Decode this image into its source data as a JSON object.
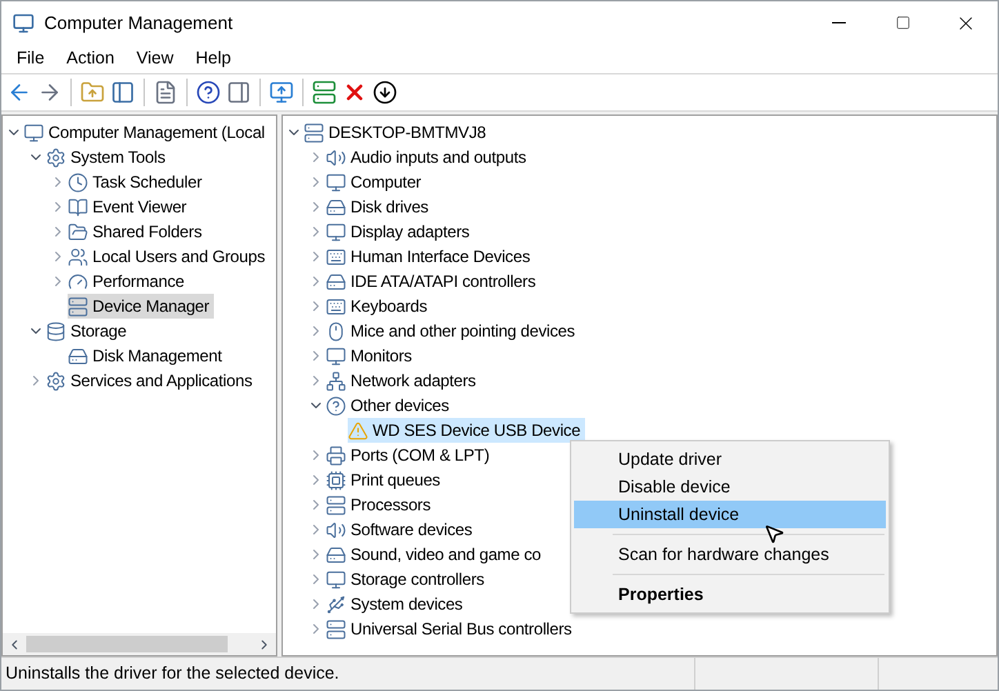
{
  "window": {
    "title": "Computer Management"
  },
  "menu": [
    {
      "label": "File"
    },
    {
      "label": "Action"
    },
    {
      "label": "View"
    },
    {
      "label": "Help"
    }
  ],
  "left_tree": [
    {
      "label": "Computer Management (Local",
      "expanded": true,
      "selected": false,
      "children": [
        {
          "label": "System Tools",
          "expanded": true,
          "selected": false,
          "children": [
            {
              "label": "Task Scheduler",
              "expanded": false,
              "selected": false
            },
            {
              "label": "Event Viewer",
              "expanded": false,
              "selected": false
            },
            {
              "label": "Shared Folders",
              "expanded": false,
              "selected": false
            },
            {
              "label": "Local Users and Groups",
              "expanded": false,
              "selected": false
            },
            {
              "label": "Performance",
              "expanded": false,
              "selected": false
            },
            {
              "label": "Device Manager",
              "selected": true
            }
          ]
        },
        {
          "label": "Storage",
          "expanded": true,
          "selected": false,
          "children": [
            {
              "label": "Disk Management",
              "selected": false
            }
          ]
        },
        {
          "label": "Services and Applications",
          "expanded": false,
          "selected": false
        }
      ]
    }
  ],
  "right_tree": [
    {
      "label": "DESKTOP-BMTMVJ8",
      "expanded": true,
      "selected": false,
      "children": [
        {
          "label": "Audio inputs and outputs",
          "expanded": false,
          "selected": false
        },
        {
          "label": "Computer",
          "expanded": false,
          "selected": false
        },
        {
          "label": "Disk drives",
          "expanded": false,
          "selected": false
        },
        {
          "label": "Display adapters",
          "expanded": false,
          "selected": false
        },
        {
          "label": "Human Interface Devices",
          "expanded": false,
          "selected": false
        },
        {
          "label": "IDE ATA/ATAPI controllers",
          "expanded": false,
          "selected": false
        },
        {
          "label": "Keyboards",
          "expanded": false,
          "selected": false
        },
        {
          "label": "Mice and other pointing devices",
          "expanded": false,
          "selected": false
        },
        {
          "label": "Monitors",
          "expanded": false,
          "selected": false
        },
        {
          "label": "Network adapters",
          "expanded": false,
          "selected": false
        },
        {
          "label": "Other devices",
          "expanded": true,
          "selected": false,
          "children": [
            {
              "label": "WD SES Device USB Device",
              "selected": true,
              "warning": true
            }
          ]
        },
        {
          "label": "Ports (COM & LPT)",
          "expanded": false,
          "selected": false
        },
        {
          "label": "Print queues",
          "expanded": false,
          "selected": false
        },
        {
          "label": "Processors",
          "expanded": false,
          "selected": false
        },
        {
          "label": "Software devices",
          "expanded": false,
          "selected": false
        },
        {
          "label": "Sound, video and game co",
          "expanded": false,
          "selected": false
        },
        {
          "label": "Storage controllers",
          "expanded": false,
          "selected": false
        },
        {
          "label": "System devices",
          "expanded": false,
          "selected": false
        },
        {
          "label": "Universal Serial Bus controllers",
          "expanded": false,
          "selected": false
        }
      ]
    }
  ],
  "context_menu": [
    {
      "kind": "item",
      "label": "Update driver",
      "selected": false
    },
    {
      "kind": "item",
      "label": "Disable device",
      "selected": false
    },
    {
      "kind": "item",
      "label": "Uninstall device",
      "selected": true
    },
    {
      "kind": "separator"
    },
    {
      "kind": "item",
      "label": "Scan for hardware changes",
      "selected": false
    },
    {
      "kind": "separator"
    },
    {
      "kind": "default",
      "label": "Properties",
      "selected": false
    }
  ],
  "status_bar": {
    "text": "Uninstalls the driver for the selected device."
  }
}
